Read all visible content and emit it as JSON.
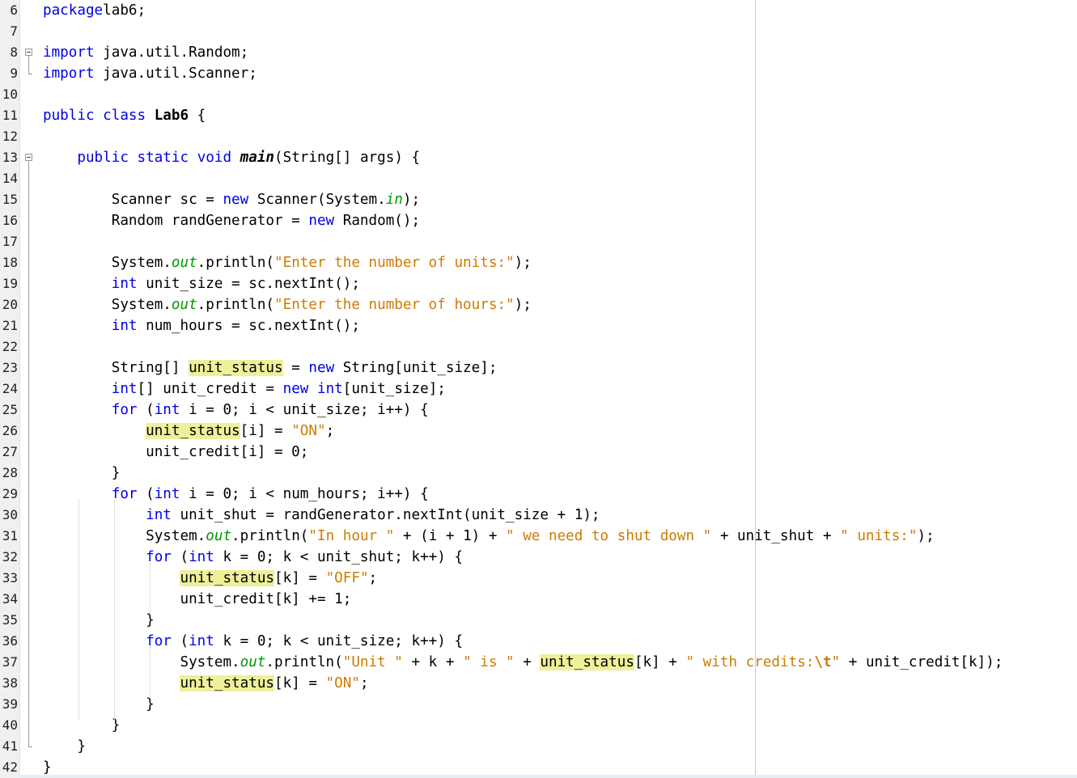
{
  "editor": {
    "language": "java",
    "highlighted_identifier": "unit_status",
    "colors": {
      "keyword": "#0000e6",
      "string": "#ce7b00",
      "static_field": "#009900",
      "highlight": "#eef09a",
      "margin_line": "#e8b8b8"
    },
    "lines": [
      {
        "n": "6",
        "tokens": [
          [
            "kw",
            "package"
          ],
          [
            "",
            "lab6;"
          ]
        ]
      },
      {
        "n": "7",
        "tokens": []
      },
      {
        "n": "8",
        "tokens": [
          [
            "kw",
            "import"
          ],
          [
            "",
            " java.util.Random;"
          ]
        ]
      },
      {
        "n": "9",
        "tokens": [
          [
            "kw",
            "import"
          ],
          [
            "",
            " java.util.Scanner;"
          ]
        ]
      },
      {
        "n": "10",
        "tokens": []
      },
      {
        "n": "11",
        "tokens": [
          [
            "kw",
            "public"
          ],
          [
            "",
            " "
          ],
          [
            "kw",
            "class"
          ],
          [
            "",
            " "
          ],
          [
            "b",
            "Lab6"
          ],
          [
            "",
            " {"
          ]
        ]
      },
      {
        "n": "12",
        "tokens": []
      },
      {
        "n": "13",
        "tokens": [
          [
            "",
            "    "
          ],
          [
            "kw",
            "public"
          ],
          [
            "",
            " "
          ],
          [
            "kw",
            "static"
          ],
          [
            "",
            " "
          ],
          [
            "kw",
            "void"
          ],
          [
            "",
            " "
          ],
          [
            "bi",
            "main"
          ],
          [
            "",
            "(String[] args) {"
          ]
        ]
      },
      {
        "n": "14",
        "tokens": []
      },
      {
        "n": "15",
        "tokens": [
          [
            "",
            "        Scanner sc = "
          ],
          [
            "kw",
            "new"
          ],
          [
            "",
            " Scanner(System."
          ],
          [
            "fld",
            "in"
          ],
          [
            "",
            ");"
          ]
        ]
      },
      {
        "n": "16",
        "tokens": [
          [
            "",
            "        Random randGenerator = "
          ],
          [
            "kw",
            "new"
          ],
          [
            "",
            " Random();"
          ]
        ]
      },
      {
        "n": "17",
        "tokens": []
      },
      {
        "n": "18",
        "tokens": [
          [
            "",
            "        System."
          ],
          [
            "fld",
            "out"
          ],
          [
            "",
            ".println("
          ],
          [
            "str",
            "\"Enter the number of units:\""
          ],
          [
            "",
            ");"
          ]
        ]
      },
      {
        "n": "19",
        "tokens": [
          [
            "",
            "        "
          ],
          [
            "kw",
            "int"
          ],
          [
            "",
            " unit_size = sc.nextInt();"
          ]
        ]
      },
      {
        "n": "20",
        "tokens": [
          [
            "",
            "        System."
          ],
          [
            "fld",
            "out"
          ],
          [
            "",
            ".println("
          ],
          [
            "str",
            "\"Enter the number of hours:\""
          ],
          [
            "",
            ");"
          ]
        ]
      },
      {
        "n": "21",
        "tokens": [
          [
            "",
            "        "
          ],
          [
            "kw",
            "int"
          ],
          [
            "",
            " num_hours = sc.nextInt();"
          ]
        ]
      },
      {
        "n": "22",
        "tokens": []
      },
      {
        "n": "23",
        "tokens": [
          [
            "",
            "        String[] "
          ],
          [
            "hl",
            "unit_status"
          ],
          [
            "",
            " = "
          ],
          [
            "kw",
            "new"
          ],
          [
            "",
            " String[unit_size];"
          ]
        ]
      },
      {
        "n": "24",
        "tokens": [
          [
            "",
            "        "
          ],
          [
            "kw",
            "int"
          ],
          [
            "",
            "[] unit_credit = "
          ],
          [
            "kw",
            "new"
          ],
          [
            "",
            " "
          ],
          [
            "kw",
            "int"
          ],
          [
            "",
            "[unit_size];"
          ]
        ]
      },
      {
        "n": "25",
        "tokens": [
          [
            "",
            "        "
          ],
          [
            "kw",
            "for"
          ],
          [
            "",
            " ("
          ],
          [
            "kw",
            "int"
          ],
          [
            "",
            " i = 0; i < unit_size; i++) {"
          ]
        ]
      },
      {
        "n": "26",
        "tokens": [
          [
            "",
            "            "
          ],
          [
            "hl",
            "unit_status"
          ],
          [
            "",
            "[i] = "
          ],
          [
            "str",
            "\"ON\""
          ],
          [
            "",
            ";"
          ]
        ]
      },
      {
        "n": "27",
        "tokens": [
          [
            "",
            "            unit_credit[i] = 0;"
          ]
        ]
      },
      {
        "n": "28",
        "tokens": [
          [
            "",
            "        }"
          ]
        ]
      },
      {
        "n": "29",
        "tokens": [
          [
            "",
            "        "
          ],
          [
            "kw",
            "for"
          ],
          [
            "",
            " ("
          ],
          [
            "kw",
            "int"
          ],
          [
            "",
            " i = 0; i < num_hours; i++) {"
          ]
        ]
      },
      {
        "n": "30",
        "tokens": [
          [
            "",
            "            "
          ],
          [
            "kw",
            "int"
          ],
          [
            "",
            " unit_shut = randGenerator.nextInt(unit_size + 1);"
          ]
        ]
      },
      {
        "n": "31",
        "tokens": [
          [
            "",
            "            System."
          ],
          [
            "fld",
            "out"
          ],
          [
            "",
            ".println("
          ],
          [
            "str",
            "\"In hour \""
          ],
          [
            "",
            " + (i + 1) + "
          ],
          [
            "str",
            "\" we need to shut down \""
          ],
          [
            "",
            " + unit_shut + "
          ],
          [
            "str",
            "\" units:\""
          ],
          [
            "",
            ");"
          ]
        ]
      },
      {
        "n": "32",
        "tokens": [
          [
            "",
            "            "
          ],
          [
            "kw",
            "for"
          ],
          [
            "",
            " ("
          ],
          [
            "kw",
            "int"
          ],
          [
            "",
            " k = 0; k < unit_shut; k++) {"
          ]
        ]
      },
      {
        "n": "33",
        "tokens": [
          [
            "",
            "                "
          ],
          [
            "hl",
            "unit_status"
          ],
          [
            "",
            "[k] = "
          ],
          [
            "str",
            "\"OFF\""
          ],
          [
            "",
            ";"
          ]
        ]
      },
      {
        "n": "34",
        "tokens": [
          [
            "",
            "                unit_credit[k] += 1;"
          ]
        ]
      },
      {
        "n": "35",
        "tokens": [
          [
            "",
            "            }"
          ]
        ]
      },
      {
        "n": "36",
        "tokens": [
          [
            "",
            "            "
          ],
          [
            "kw",
            "for"
          ],
          [
            "",
            " ("
          ],
          [
            "kw",
            "int"
          ],
          [
            "",
            " k = 0; k < unit_size; k++) {"
          ]
        ]
      },
      {
        "n": "37",
        "tokens": [
          [
            "",
            "                System."
          ],
          [
            "fld",
            "out"
          ],
          [
            "",
            ".println("
          ],
          [
            "str",
            "\"Unit \""
          ],
          [
            "",
            " + k + "
          ],
          [
            "str",
            "\" is \""
          ],
          [
            "",
            " + "
          ],
          [
            "hl",
            "unit_status"
          ],
          [
            "",
            "[k] + "
          ],
          [
            "str",
            "\" with credits:"
          ],
          [
            "esc",
            "\\t"
          ],
          [
            "str",
            "\""
          ],
          [
            "",
            " + unit_credit[k]);"
          ]
        ]
      },
      {
        "n": "38",
        "tokens": [
          [
            "",
            "                "
          ],
          [
            "hl",
            "unit_status"
          ],
          [
            "",
            "[k] = "
          ],
          [
            "str",
            "\"ON\""
          ],
          [
            "",
            ";"
          ]
        ]
      },
      {
        "n": "39",
        "tokens": [
          [
            "",
            "            }"
          ]
        ]
      },
      {
        "n": "40",
        "tokens": [
          [
            "",
            "        }"
          ]
        ]
      },
      {
        "n": "41",
        "tokens": [
          [
            "",
            "    }"
          ]
        ]
      },
      {
        "n": "42",
        "tokens": [
          [
            "",
            "}"
          ]
        ]
      }
    ]
  }
}
